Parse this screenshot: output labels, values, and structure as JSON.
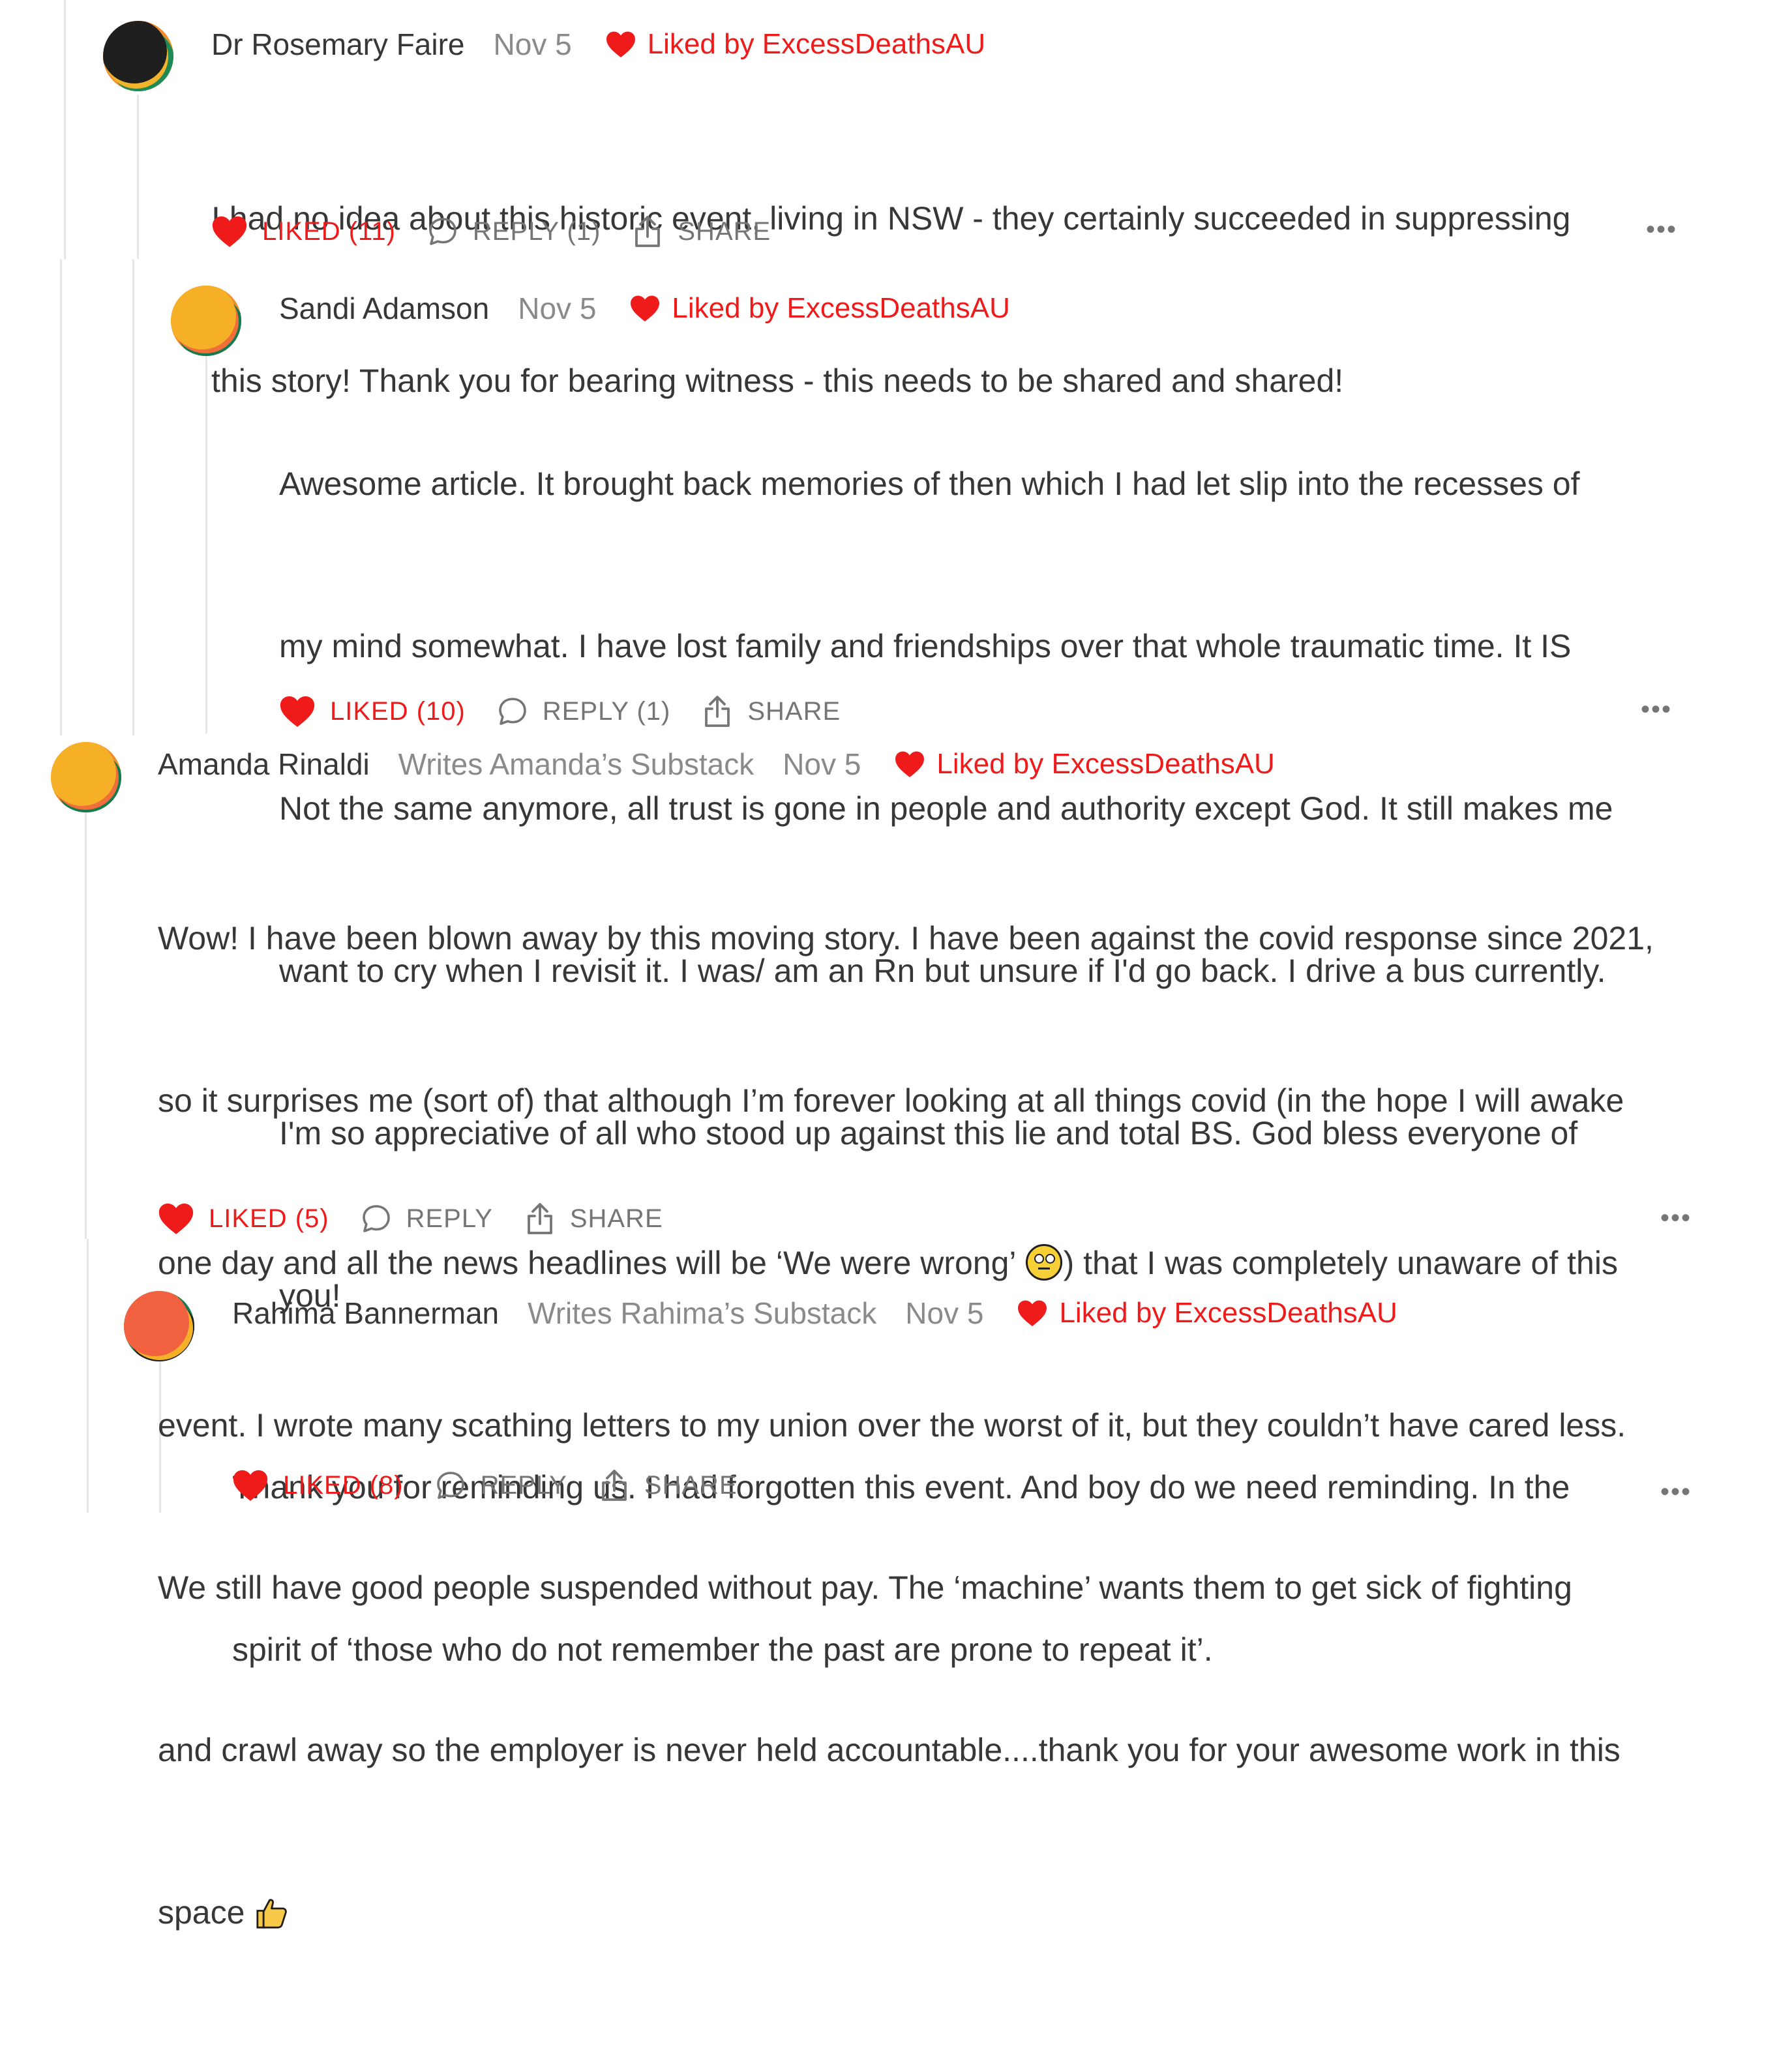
{
  "colors": {
    "like_red": "#ef1b1b",
    "text": "#363737",
    "muted": "#8a8a8a",
    "action_gray": "#757575",
    "thread_line": "#e6e6e6"
  },
  "icons": {
    "like": "heart-icon",
    "reply": "speech-bubble-icon",
    "share": "share-upload-icon",
    "more": "ellipsis-icon",
    "liked_by": "heart-icon"
  },
  "comments": [
    {
      "author": "Dr Rosemary Faire",
      "publication": "",
      "date": "Nov 5",
      "liked_by": "Liked by ExcessDeathsAU",
      "body_lines": [
        "I had no idea about this historic event, living in NSW - they certainly succeeded in suppressing",
        "this story! Thank you for bearing witness - this needs to be shared and shared!"
      ],
      "like_label": "LIKED (11)",
      "reply_label": "REPLY (1)",
      "share_label": "SHARE",
      "more_label": "•••"
    },
    {
      "author": "Sandi Adamson",
      "publication": "",
      "date": "Nov 5",
      "liked_by": "Liked by ExcessDeathsAU",
      "body_lines": [
        "Awesome article. It brought back memories of then which I had let slip into the recesses of",
        "my mind somewhat. I have lost family and friendships over that whole traumatic time. It IS",
        "Not the same anymore, all trust is gone in people and authority except God. It still makes me",
        "want to cry when I revisit it. I was/ am an Rn but unsure if I'd go back. I drive a bus currently.",
        "I'm so appreciative of all who stood up against this lie and total BS. God bless everyone of",
        "you!"
      ],
      "like_label": "LIKED (10)",
      "reply_label": "REPLY (1)",
      "share_label": "SHARE",
      "more_label": "•••"
    },
    {
      "author": "Amanda Rinaldi",
      "publication": "Writes Amanda’s Substack",
      "date": "Nov 5",
      "liked_by": "Liked by ExcessDeathsAU",
      "body_lines": [
        "Wow! I have been blown away by this moving story. I have been against the covid response since 2021,",
        "so it surprises me (sort of) that although I’m forever looking at all things covid (in the hope I will awake",
        "one day and all the news headlines will be ‘We were wrong’",
        "event. I wrote many scathing letters to my union over the worst of it, but they couldn’t have cared less.",
        "We still have good people suspended without pay. The ‘machine’ wants them to get sick of fighting",
        "and crawl away so the employer is never held accountable....thank you for your awesome work in this",
        "space"
      ],
      "line3_tail": ") that I was completely unaware of this",
      "like_label": "LIKED (5)",
      "reply_label": "REPLY",
      "share_label": "SHARE",
      "more_label": "•••"
    },
    {
      "author": "Rahima Bannerman",
      "publication": "Writes Rahima’s Substack",
      "date": "Nov 5",
      "liked_by": "Liked by ExcessDeathsAU",
      "body_lines": [
        "Thank you for reminding us. I had forgotten this event. And boy do we need reminding. In the",
        "spirit of ‘those who do not remember the past are prone to repeat it’."
      ],
      "like_label": "LIKED (8)",
      "reply_label": "REPLY",
      "share_label": "SHARE",
      "more_label": "•••"
    }
  ]
}
